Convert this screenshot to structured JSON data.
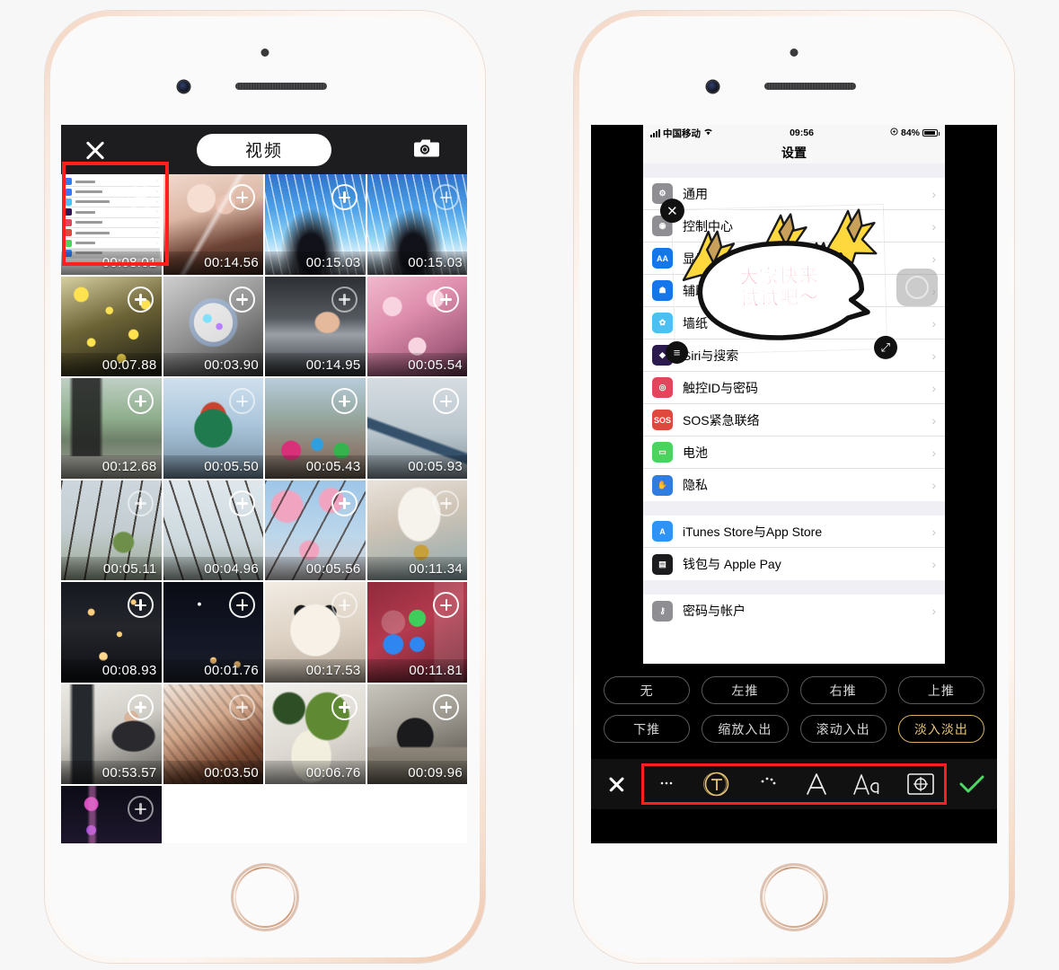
{
  "page": {
    "background": "#f7f7f7"
  },
  "left_phone": {
    "app_title": "视频",
    "close_icon": "close-x-icon",
    "camera_icon": "camera-icon",
    "highlight_color": "#ff1f1f",
    "thumbnails": [
      {
        "duration": "00:08.01",
        "kind": "settings-screenshot",
        "selected": true
      },
      {
        "duration": "00:14.56",
        "kind": "portrait-girl"
      },
      {
        "duration": "00:15.03",
        "kind": "concert-lights"
      },
      {
        "duration": "00:15.03",
        "kind": "concert-lights"
      },
      {
        "duration": "00:07.88",
        "kind": "yellow-flowers"
      },
      {
        "duration": "00:03.90",
        "kind": "soap-bubble"
      },
      {
        "duration": "00:14.95",
        "kind": "car-window"
      },
      {
        "duration": "00:05.54",
        "kind": "cherry-blossom"
      },
      {
        "duration": "00:12.68",
        "kind": "train"
      },
      {
        "duration": "00:05.50",
        "kind": "carousel"
      },
      {
        "duration": "00:05.43",
        "kind": "bumper-cars"
      },
      {
        "duration": "00:05.93",
        "kind": "roller-coaster"
      },
      {
        "duration": "00:05.11",
        "kind": "bare-trees"
      },
      {
        "duration": "00:04.96",
        "kind": "bare-trees-sky"
      },
      {
        "duration": "00:05.56",
        "kind": "pink-blossom"
      },
      {
        "duration": "00:11.34",
        "kind": "dog-bell"
      },
      {
        "duration": "00:08.93",
        "kind": "night-street"
      },
      {
        "duration": "00:01.76",
        "kind": "night-city"
      },
      {
        "duration": "00:17.53",
        "kind": "dog-face"
      },
      {
        "duration": "00:11.81",
        "kind": "control-center"
      },
      {
        "duration": "00:53.57",
        "kind": "office-desk"
      },
      {
        "duration": "00:03.50",
        "kind": "hair-back"
      },
      {
        "duration": "00:06.76",
        "kind": "food-bowls"
      },
      {
        "duration": "00:09.96",
        "kind": "office-chair"
      },
      {
        "duration": "",
        "kind": "pearl-tower"
      }
    ]
  },
  "right_phone": {
    "status_bar": {
      "carrier": "中国移动",
      "time": "09:56",
      "battery_percent": "84%",
      "signal_icon": "signal-bars-icon",
      "wifi_icon": "wifi-icon",
      "lock_icon": "rotation-lock-icon",
      "battery_icon": "battery-icon"
    },
    "nav_title": "设置",
    "settings_groups": [
      {
        "rows": [
          {
            "label": "通用",
            "icon": "gear-icon",
            "color": "#8e8e93"
          },
          {
            "label": "控制中心",
            "icon": "control-center-icon",
            "color": "#8e8e93"
          },
          {
            "label": "显示与亮度",
            "icon": "aa-icon",
            "color": "#1576ec"
          },
          {
            "label": "辅助功能",
            "icon": "accessibility-icon",
            "color": "#1576ec"
          },
          {
            "label": "墙纸",
            "icon": "wallpaper-icon",
            "color": "#4cc0f0"
          },
          {
            "label": "Siri与搜索",
            "icon": "siri-icon",
            "color": "#2b1a4d"
          },
          {
            "label": "触控ID与密码",
            "icon": "touchid-icon",
            "color": "#e2455c"
          },
          {
            "label": "SOS紧急联络",
            "icon": "sos-icon",
            "color": "#e0483e"
          },
          {
            "label": "电池",
            "icon": "battery-green-icon",
            "color": "#4cd35e"
          },
          {
            "label": "隐私",
            "icon": "hand-icon",
            "color": "#2f7de1"
          }
        ]
      },
      {
        "rows": [
          {
            "label": "iTunes Store与App Store",
            "icon": "appstore-icon",
            "color": "#2f93f5"
          },
          {
            "label": "钱包与 Apple Pay",
            "icon": "wallet-icon",
            "color": "#1c1c1e"
          }
        ]
      },
      {
        "rows": [
          {
            "label": "密码与帐户",
            "icon": "key-icon",
            "color": "#8e8e93"
          }
        ]
      }
    ],
    "sticker": {
      "text": "大家快来\n试试吧～",
      "text_color": "#f2607a",
      "delete_icon": "close-x-icon",
      "scale_icon": "resize-diagonal-icon",
      "menu_icon": "hamburger-icon",
      "decoration": "stars-speech-bubble"
    },
    "animation_buttons": [
      {
        "label": "无",
        "selected": false
      },
      {
        "label": "左推",
        "selected": false
      },
      {
        "label": "右推",
        "selected": false
      },
      {
        "label": "上推",
        "selected": false
      },
      {
        "label": "下推",
        "selected": false
      },
      {
        "label": "缩放入出",
        "selected": false
      },
      {
        "label": "滚动入出",
        "selected": false
      },
      {
        "label": "淡入淡出",
        "selected": true
      }
    ],
    "toolbar": {
      "cancel_icon": "close-x-icon",
      "confirm_icon": "check-icon",
      "confirm_color": "#4cd964",
      "highlight_color": "#ff1f1f",
      "items": [
        {
          "icon": "speech-bubble-icon",
          "selected": false
        },
        {
          "icon": "circled-t-text-icon",
          "selected": true
        },
        {
          "icon": "palette-icon",
          "selected": false
        },
        {
          "icon": "outline-a-icon",
          "selected": false
        },
        {
          "icon": "aa-font-icon",
          "selected": false
        },
        {
          "icon": "target-frame-icon",
          "selected": false
        }
      ],
      "selected_color": "#e8c477"
    }
  }
}
